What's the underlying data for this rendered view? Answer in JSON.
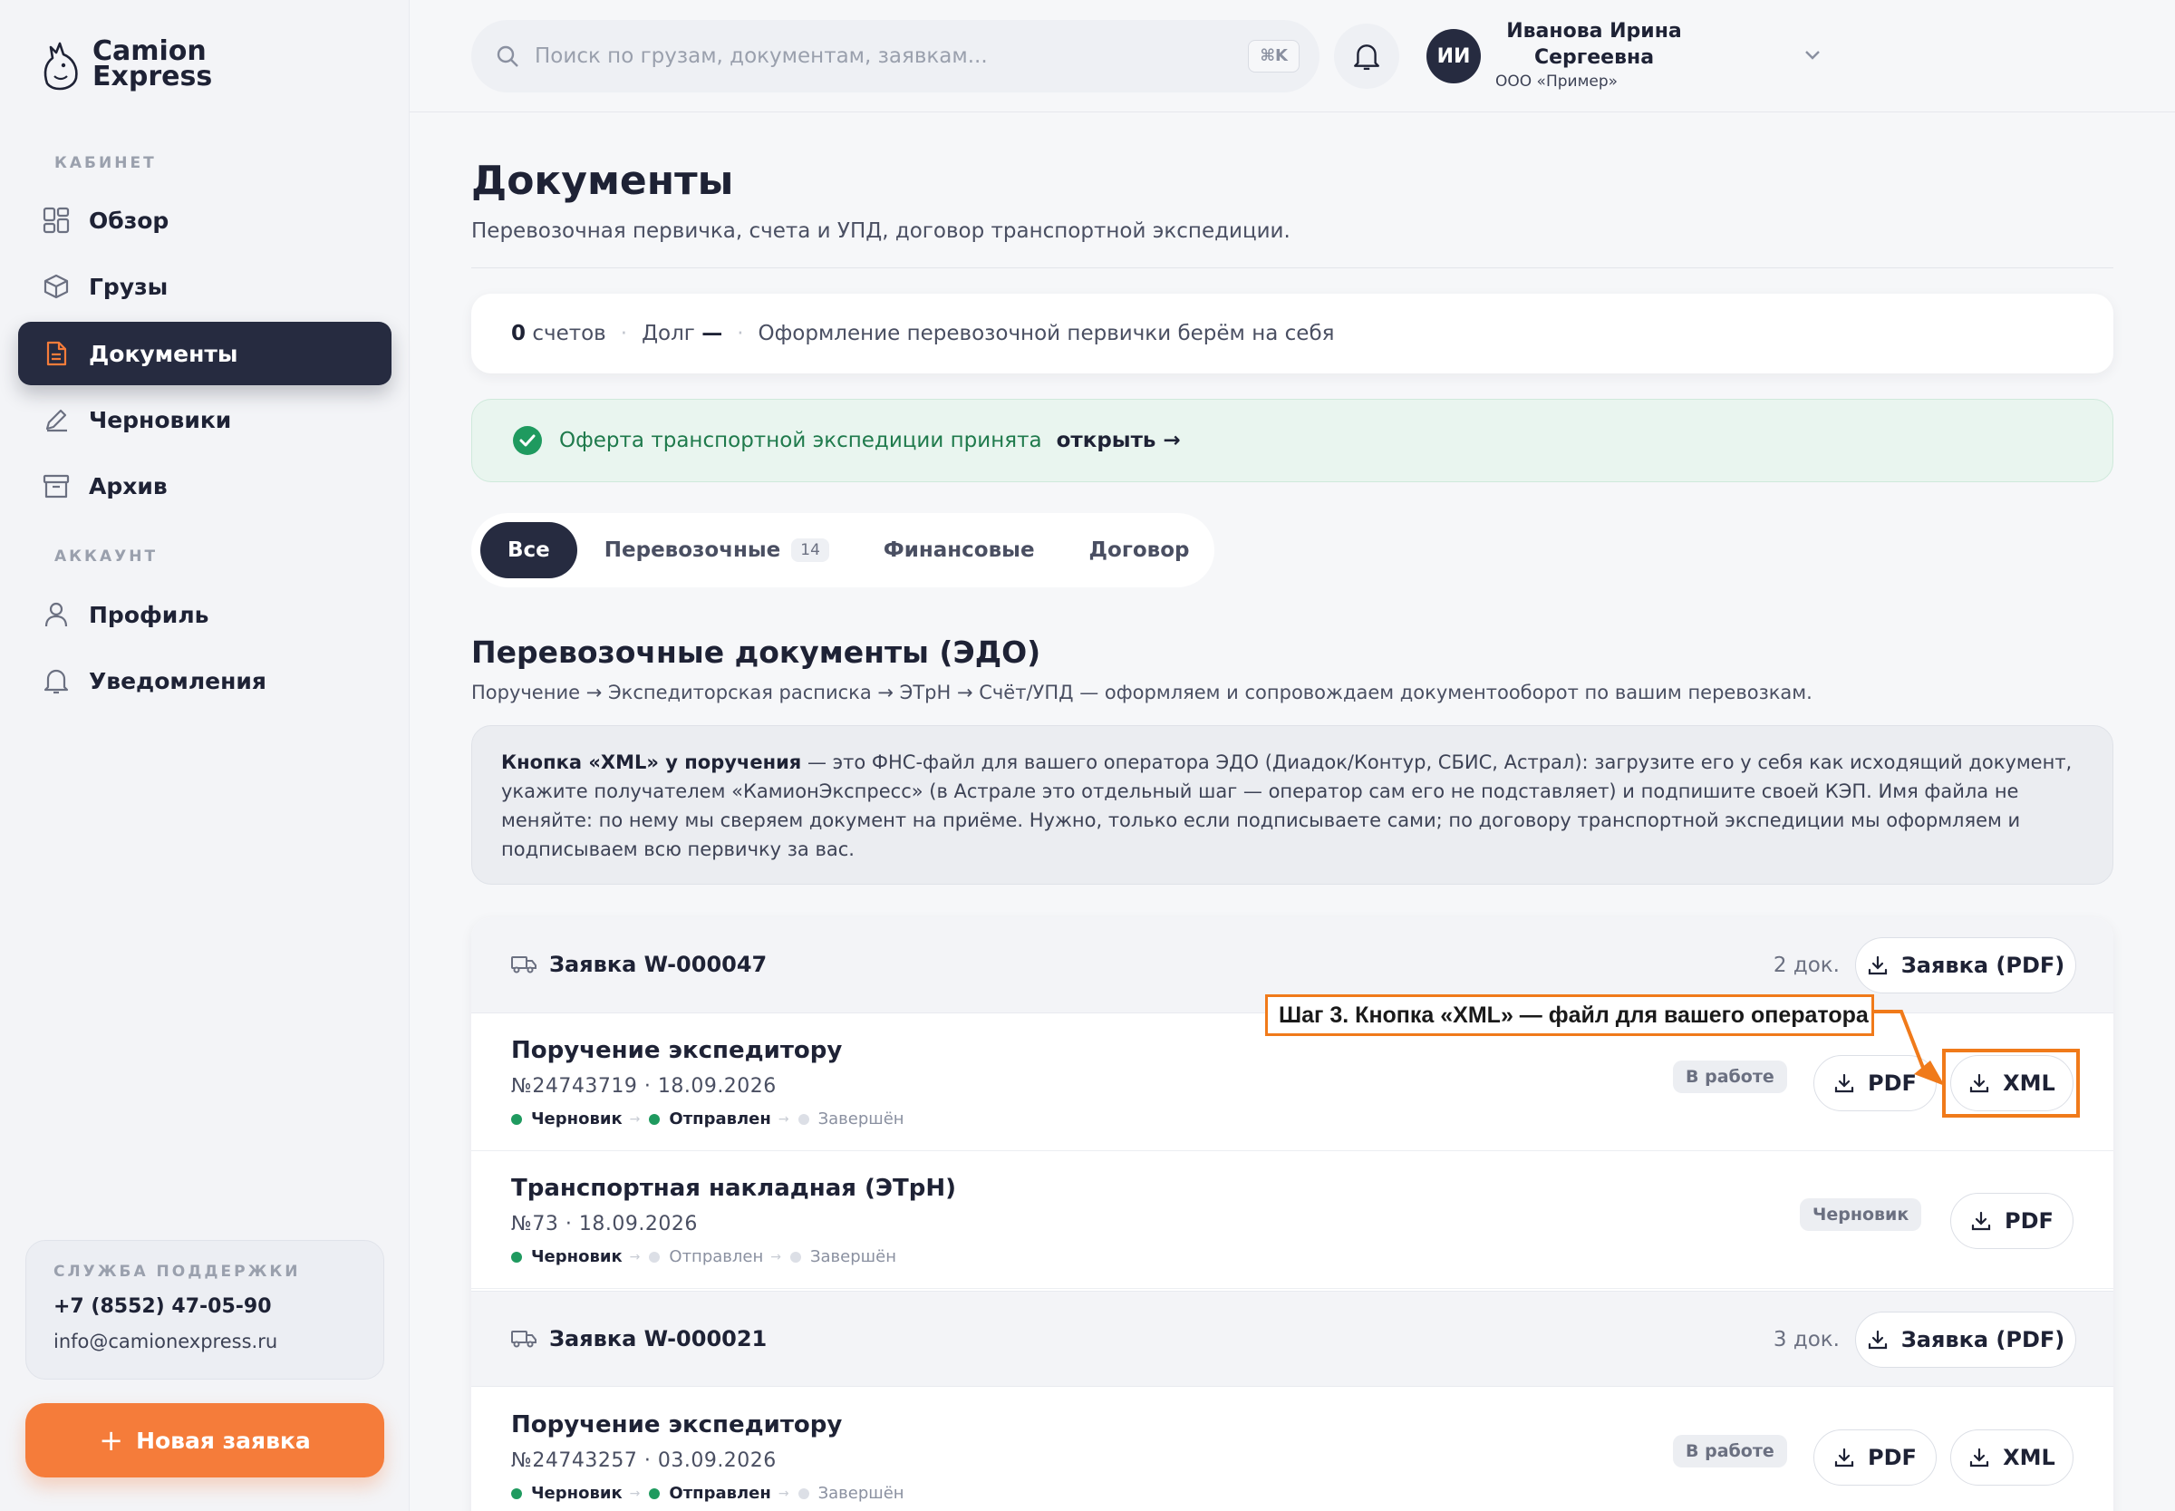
{
  "brand": {
    "line1": "Camion",
    "line2": "Express"
  },
  "sidebar": {
    "section_cabinet": "КАБИНЕТ",
    "section_account": "АККАУНТ",
    "items": [
      {
        "label": "Обзор",
        "icon": "grid-icon"
      },
      {
        "label": "Грузы",
        "icon": "box-icon"
      },
      {
        "label": "Документы",
        "icon": "document-icon",
        "active": true
      },
      {
        "label": "Черновики",
        "icon": "pencil-icon"
      },
      {
        "label": "Архив",
        "icon": "archive-icon"
      },
      {
        "label": "Профиль",
        "icon": "user-icon"
      },
      {
        "label": "Уведомления",
        "icon": "bell-icon"
      }
    ],
    "support": {
      "title": "СЛУЖБА ПОДДЕРЖКИ",
      "phone": "+7 (8552) 47-05-90",
      "email": "info@camionexpress.ru"
    },
    "new_button": "Новая заявка"
  },
  "header": {
    "search_placeholder": "Поиск по грузам, документам, заявкам...",
    "shortcut": "⌘K",
    "user": {
      "initials": "ИИ",
      "name": "Иванова Ирина Сергеевна",
      "org": "ООО «Пример»"
    }
  },
  "page": {
    "title": "Документы",
    "subtitle": "Перевозочная первичка, счета и УПД, договор транспортной экспедиции.",
    "stats": {
      "count": "0",
      "count_label": "счетов",
      "debt_label": "Долг",
      "debt_value": "—",
      "note": "Оформление перевозочной первички берём на себя"
    },
    "offer": {
      "text": "Оферта транспортной экспедиции принята",
      "link": "открыть →"
    },
    "tabs": [
      {
        "label": "Все",
        "active": true
      },
      {
        "label": "Перевозочные",
        "count": "14"
      },
      {
        "label": "Финансовые"
      },
      {
        "label": "Договор"
      }
    ],
    "section": {
      "title": "Перевозочные документы (ЭДО)",
      "subtitle": "Поручение → Экспедиторская расписка → ЭТрН → Счёт/УПД — оформляем и сопровождаем документооборот по вашим перевозкам.",
      "note_bold": "Кнопка «XML» у поручения",
      "note_text": " — это ФНС-файл для вашего оператора ЭДО (Диадок/Контур, СБИС, Астрал): загрузите его у себя как исходящий документ, укажите получателем «КамионЭкспресс» (в Астрале это отдельный шаг — оператор сам его не подставляет) и подпишите своей КЭП. Имя файла не меняйте: по нему мы сверяем документ на приёме. Нужно, только если подписываете сами; по договору транспортной экспедиции мы оформляем и подписываем всю первичку за вас."
    },
    "groups": [
      {
        "title": "Заявка W-000047",
        "count": "2 док.",
        "button": "Заявка (PDF)",
        "docs": [
          {
            "title": "Поручение экспедитору",
            "meta": "№24743719 · 18.09.2026",
            "badge": "В работе",
            "pdf": "PDF",
            "xml": "XML",
            "steps": [
              {
                "label": "Черновик",
                "done": true
              },
              {
                "label": "Отправлен",
                "done": true
              },
              {
                "label": "Завершён",
                "done": false
              }
            ]
          },
          {
            "title": "Транспортная накладная (ЭТрН)",
            "meta": "№73 · 18.09.2026",
            "badge": "Черновик",
            "pdf": "PDF",
            "steps": [
              {
                "label": "Черновик",
                "done": true
              },
              {
                "label": "Отправлен",
                "done": false
              },
              {
                "label": "Завершён",
                "done": false
              }
            ]
          }
        ]
      },
      {
        "title": "Заявка W-000021",
        "count": "3 док.",
        "button": "Заявка (PDF)",
        "docs": [
          {
            "title": "Поручение экспедитору",
            "meta": "№24743257 · 03.09.2026",
            "badge": "В работе",
            "pdf": "PDF",
            "xml": "XML",
            "steps": [
              {
                "label": "Черновик",
                "done": true
              },
              {
                "label": "Отправлен",
                "done": true
              },
              {
                "label": "Завершён",
                "done": false
              }
            ]
          }
        ]
      }
    ]
  },
  "annotation": {
    "text": "Шаг 3. Кнопка «XML» — файл для вашего оператора",
    "color": "#f07a1a"
  },
  "colors": {
    "accent": "#f57c3a",
    "dark": "#262b40",
    "success": "#1f9a5f"
  }
}
